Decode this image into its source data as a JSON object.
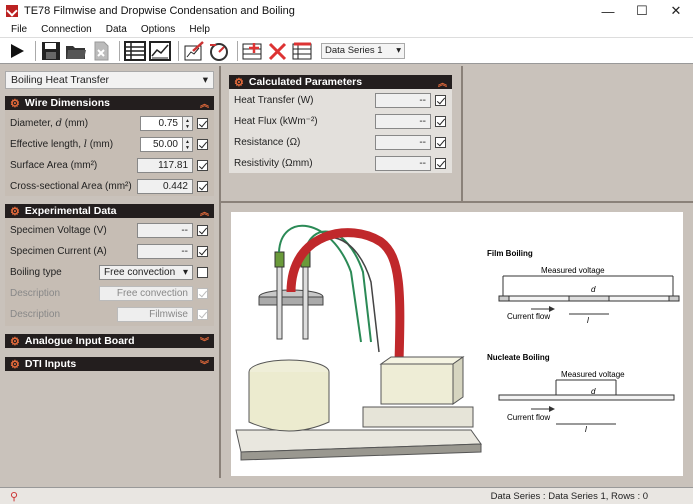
{
  "window": {
    "title": "TE78 Filmwise and Dropwise Condensation and Boiling",
    "minimize": "—",
    "maximize": "☐",
    "close": "✕"
  },
  "menu": [
    "File",
    "Connection",
    "Data",
    "Options",
    "Help"
  ],
  "toolbar": {
    "series_value": "Data Series 1"
  },
  "mode": {
    "selected": "Boiling Heat Transfer"
  },
  "wire_dimensions": {
    "title": "Wire Dimensions",
    "rows": [
      {
        "label": "Diameter, d (mm)",
        "value": "0.75",
        "checked": true
      },
      {
        "label": "Effective length, l (mm)",
        "value": "50.00",
        "checked": true
      },
      {
        "label": "Surface Area (mm²)",
        "value": "117.81",
        "checked": true
      },
      {
        "label": "Cross-sectional Area (mm²)",
        "value": "0.442",
        "checked": true
      }
    ]
  },
  "experimental_data": {
    "title": "Experimental Data",
    "voltage_label": "Specimen Voltage (V)",
    "voltage_value": "--",
    "current_label": "Specimen Current (A)",
    "current_value": "--",
    "boiling_type_label": "Boiling type",
    "boiling_type_value": "Free convection",
    "desc1_label": "Description",
    "desc1_value": "Free convection",
    "desc2_label": "Description",
    "desc2_value": "Filmwise"
  },
  "analogue_panel": {
    "title": "Analogue Input Board"
  },
  "dti_panel": {
    "title": "DTI Inputs"
  },
  "calculated": {
    "title": "Calculated Parameters",
    "rows": [
      {
        "label": "Heat Transfer (W)",
        "value": "--",
        "checked": true
      },
      {
        "label": "Heat Flux (kWm⁻²)",
        "value": "--",
        "checked": true
      },
      {
        "label": "Resistance (Ω)",
        "value": "--",
        "checked": true
      },
      {
        "label": "Resistivity (Ωmm)",
        "value": "--",
        "checked": true
      }
    ]
  },
  "diagram": {
    "film_title": "Film Boiling",
    "nucleate_title": "Nucleate Boiling",
    "measured_voltage": "Measured voltage",
    "current_flow": "Current flow",
    "d": "d",
    "l": "l"
  },
  "status": {
    "text": "Data Series : Data Series 1,  Rows : 0"
  }
}
